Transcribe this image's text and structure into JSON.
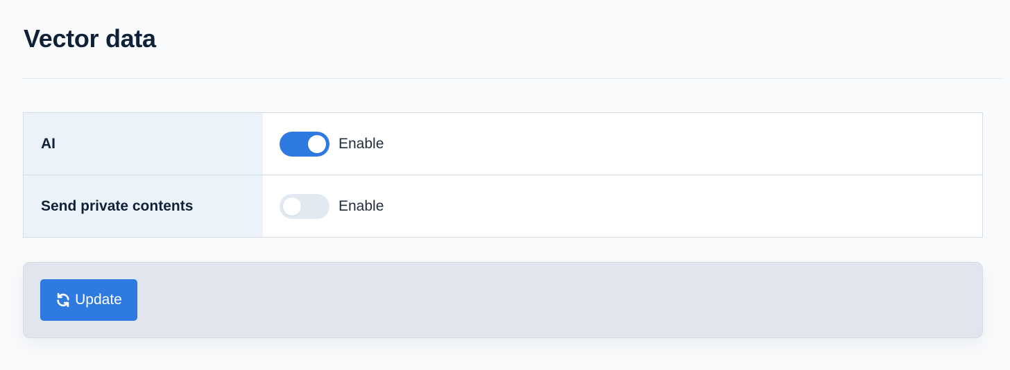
{
  "page": {
    "title": "Vector data"
  },
  "settings": [
    {
      "label": "AI",
      "toggle_state": "on",
      "toggle_text": "Enable"
    },
    {
      "label": "Send private contents",
      "toggle_state": "off",
      "toggle_text": "Enable"
    }
  ],
  "actions": {
    "update_label": "Update",
    "update_icon": "refresh-icon"
  },
  "colors": {
    "accent": "#2e7ae0",
    "toggle_off": "#e2e9f1",
    "label_bg": "#ecf2f9",
    "footer_bg": "#e1e6ee",
    "text": "#0f2137"
  }
}
